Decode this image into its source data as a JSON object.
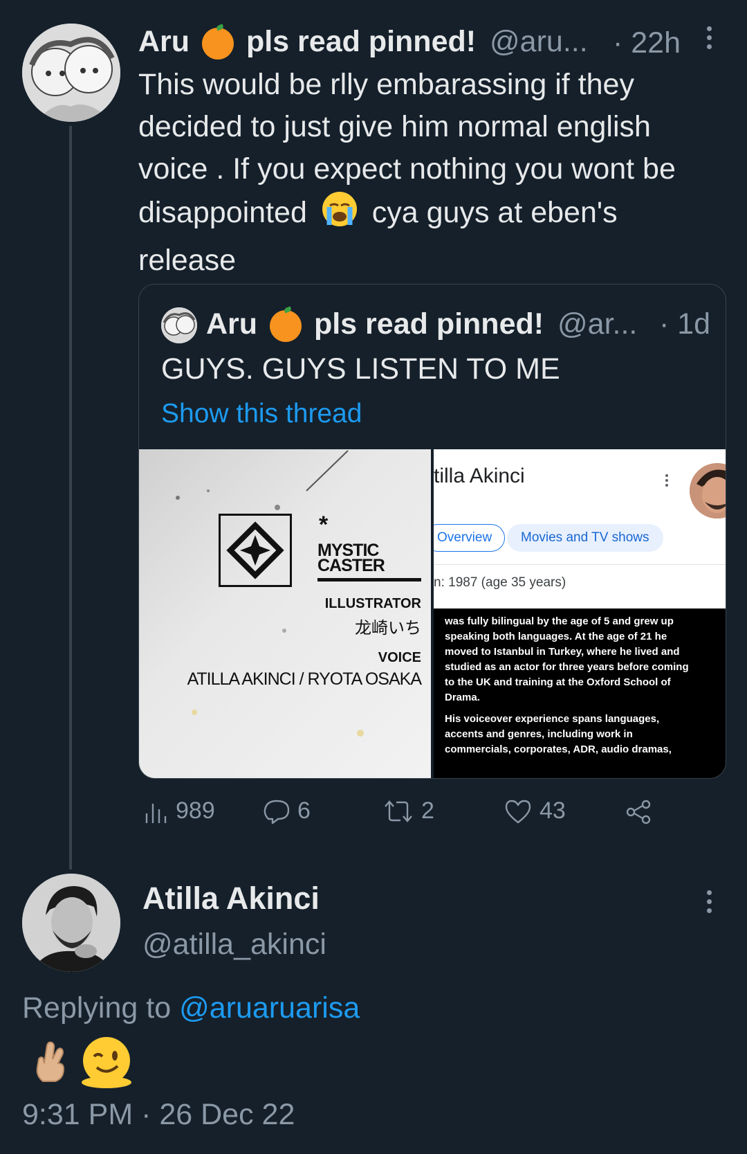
{
  "tweet": {
    "author_name_part1": "Aru",
    "author_name_part2": "pls read pinned!",
    "handle": "@aru...",
    "time": "· 22h",
    "text_line1": "This would be rlly embarassing if they",
    "text_line2": "decided to just give him normal english",
    "text_line3": "voice . If you expect nothing you wont be",
    "text_line4a": "disappointed",
    "text_line4b": "cya guys at eben's",
    "text_line5": "release",
    "quote": {
      "author_name_part1": "Aru",
      "author_name_part2": "pls read pinned!",
      "handle": "@ar...",
      "time": "· 1d",
      "text": "GUYS. GUYS LISTEN TO ME",
      "show_thread": "Show this thread",
      "media_left": {
        "brand_line1": "MYSTIC",
        "brand_line2": "CASTER",
        "illustrator_label": "ILLUSTRATOR",
        "illustrator_name": "龙崎いち",
        "voice_label": "VOICE",
        "voice_names": "ATILLA AKINCI / RYOTA OSAKA"
      },
      "media_right": {
        "name": "tilla Akinci",
        "chip_overview": "Overview",
        "chip_movies": "Movies and TV shows",
        "born": "n: 1987 (age 35 years)",
        "bio_lines": [
          "was fully bilingual by the age of 5 and grew up",
          "speaking both languages. At the age of 21 he",
          "moved to Istanbul in Turkey, where he lived and",
          "studied as an actor for three years before coming",
          "to the UK and training at the Oxford School of",
          "Drama."
        ],
        "bio2_lines": [
          "His voiceover experience spans languages,",
          "accents and genres, including work in",
          "commercials, corporates, ADR, audio dramas,"
        ]
      }
    },
    "stats": {
      "views": "989",
      "replies": "6",
      "retweets": "2",
      "likes": "43"
    }
  },
  "reply": {
    "author_name": "Atilla Akinci",
    "handle": "@atilla_akinci",
    "replying_prefix": "Replying to",
    "replying_handle": "@aruaruarisa",
    "timestamp": "9:31 PM · 26 Dec 22"
  },
  "icons": {
    "views": "bar-chart-icon",
    "reply": "speech-bubble-icon",
    "retweet": "retweet-icon",
    "like": "heart-icon",
    "share": "share-icon",
    "more": "kebab-icon"
  },
  "colors": {
    "background": "#15202b",
    "accent": "#1d9bf0",
    "muted": "#8b98a5",
    "text": "#e7e9ea"
  }
}
